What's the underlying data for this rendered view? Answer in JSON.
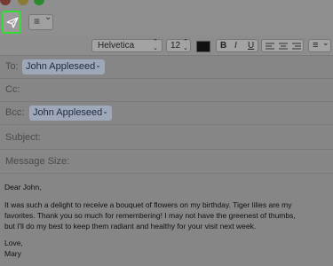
{
  "colors": {
    "traffic_red": "#7a3a34",
    "traffic_yellow": "#8a7a36",
    "traffic_green": "#2e8a2e",
    "send_highlight": "#33dd33",
    "token_bg": "#9fa8b8"
  },
  "toolbar": {
    "send_icon": "paper-plane-icon",
    "list_icon": "list-icon",
    "list_symbol": "≡",
    "chevron": "⌄"
  },
  "format_bar": {
    "font_name": "Helvetica",
    "font_size": "12",
    "bold": "B",
    "italic": "I",
    "underline": "U",
    "updown": "⌃⌄",
    "list_symbol": "≡",
    "chevron": "⌄"
  },
  "headers": {
    "to_label": "To:",
    "to_value": "John Appleseed",
    "cc_label": "Cc:",
    "bcc_label": "Bcc:",
    "bcc_value": "John Appleseed",
    "subject_label": "Subject:",
    "size_label": "Message Size:",
    "token_chevron": "⌄"
  },
  "message": {
    "greeting": "Dear John,",
    "line1": "It was such a delight to receive a bouquet of flowers on my birthday. Tiger lilies are my",
    "line2": "favorites. Thank you so much for remembering! I may not have the greenest of thumbs,",
    "line3": "but I'll do my best to keep them radiant and healthy for your visit next week.",
    "closing": "Love,",
    "signature": "Mary"
  }
}
